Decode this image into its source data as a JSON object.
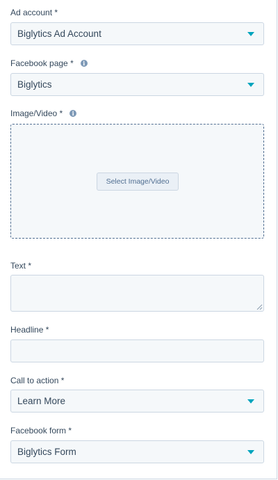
{
  "fields": {
    "ad_account": {
      "label": "Ad account *",
      "value": "Biglytics Ad Account"
    },
    "facebook_page": {
      "label": "Facebook page *",
      "value": "Biglytics",
      "info_icon": "info-icon"
    },
    "media": {
      "label": "Image/Video *",
      "button_label": "Select Image/Video",
      "info_icon": "info-icon"
    },
    "text": {
      "label": "Text *",
      "value": ""
    },
    "headline": {
      "label": "Headline *",
      "value": ""
    },
    "call_to_action": {
      "label": "Call to action *",
      "value": "Learn More"
    },
    "facebook_form": {
      "label": "Facebook form *",
      "value": "Biglytics Form"
    }
  },
  "colors": {
    "accent": "#00a4bd",
    "field_bg": "#f5f8fa",
    "border": "#cbd6e2",
    "text": "#33475b"
  }
}
